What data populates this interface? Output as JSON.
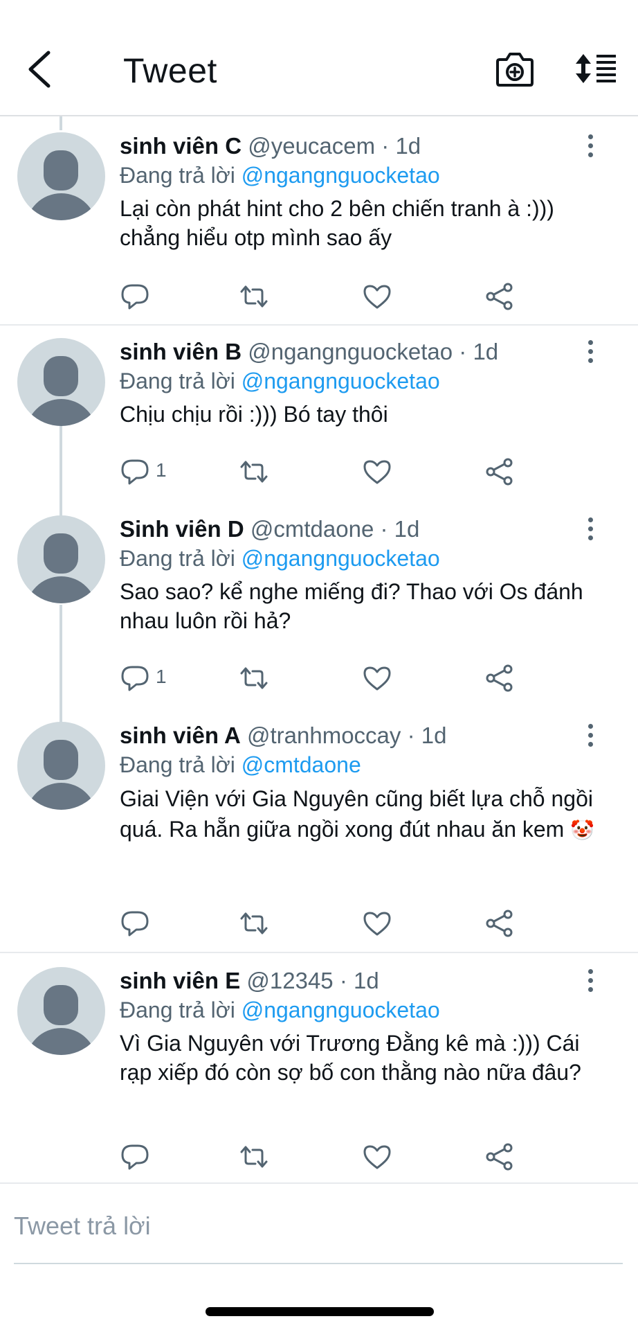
{
  "header": {
    "title": "Tweet",
    "back_icon": "back-arrow-icon",
    "camera_icon": "camera-icon",
    "sort_icon": "sort-icon"
  },
  "tweets": [
    {
      "name": "sinh viên C",
      "handle": "@yeucacem",
      "time": "· 1d",
      "replying_prefix": "Đang trả lời ",
      "replying_to": "@ngangnguocketao",
      "text": "Lại còn phát hint cho 2 bên chiến tranh à :))) chẳng hiểu otp mình sao ấy",
      "reply_count": ""
    },
    {
      "name": "sinh viên B",
      "handle": "@ngangnguocketao",
      "time": "· 1d",
      "replying_prefix": "Đang trả lời ",
      "replying_to": "@ngangnguocketao",
      "text": "Chịu chịu rồi :))) Bó tay thôi",
      "reply_count": "1"
    },
    {
      "name": "Sinh viên D",
      "handle": "@cmtdaone",
      "time": "· 1d",
      "replying_prefix": "Đang trả lời ",
      "replying_to": "@ngangnguocketao",
      "text": "Sao sao? kể nghe miếng đi? Thao với Os đánh nhau luôn rồi hả?",
      "reply_count": "1"
    },
    {
      "name": "sinh viên A",
      "handle": "@tranhmoccay",
      "time": "· 1d",
      "replying_prefix": "Đang trả lời ",
      "replying_to": "@cmtdaone",
      "text": "Giai Viện với Gia Nguyên cũng biết lựa chỗ ngồi quá. Ra hẵn giữa ngồi xong đút nhau ăn kem",
      "emoji": "🤡",
      "reply_count": ""
    },
    {
      "name": "sinh viên E",
      "handle": "@12345",
      "time": "· 1d",
      "replying_prefix": "Đang trả lời ",
      "replying_to": "@ngangnguocketao",
      "text": "Vì Gia Nguyên với Trương Đằng kê mà :))) Cái rạp xiếp đó còn sợ bố con thằng nào nữa đâu?",
      "reply_count": ""
    }
  ],
  "reply_box": {
    "placeholder": "Tweet trả lời"
  },
  "colors": {
    "accent": "#1d9bf0",
    "secondary_text": "#536471",
    "avatar_bg": "#cfd9de"
  }
}
